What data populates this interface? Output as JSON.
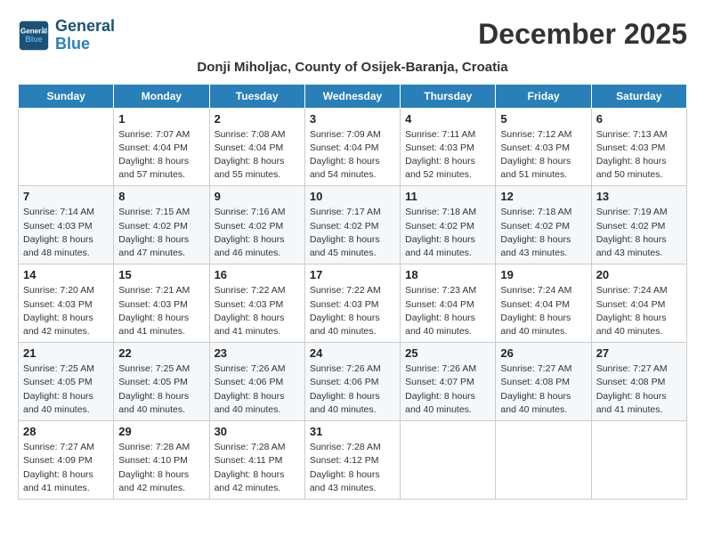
{
  "header": {
    "logo_line1": "General",
    "logo_line2": "Blue",
    "month_title": "December 2025",
    "subtitle": "Donji Miholjac, County of Osijek-Baranja, Croatia"
  },
  "weekdays": [
    "Sunday",
    "Monday",
    "Tuesday",
    "Wednesday",
    "Thursday",
    "Friday",
    "Saturday"
  ],
  "weeks": [
    [
      {
        "day": "",
        "info": ""
      },
      {
        "day": "1",
        "info": "Sunrise: 7:07 AM\nSunset: 4:04 PM\nDaylight: 8 hours\nand 57 minutes."
      },
      {
        "day": "2",
        "info": "Sunrise: 7:08 AM\nSunset: 4:04 PM\nDaylight: 8 hours\nand 55 minutes."
      },
      {
        "day": "3",
        "info": "Sunrise: 7:09 AM\nSunset: 4:04 PM\nDaylight: 8 hours\nand 54 minutes."
      },
      {
        "day": "4",
        "info": "Sunrise: 7:11 AM\nSunset: 4:03 PM\nDaylight: 8 hours\nand 52 minutes."
      },
      {
        "day": "5",
        "info": "Sunrise: 7:12 AM\nSunset: 4:03 PM\nDaylight: 8 hours\nand 51 minutes."
      },
      {
        "day": "6",
        "info": "Sunrise: 7:13 AM\nSunset: 4:03 PM\nDaylight: 8 hours\nand 50 minutes."
      }
    ],
    [
      {
        "day": "7",
        "info": "Sunrise: 7:14 AM\nSunset: 4:03 PM\nDaylight: 8 hours\nand 48 minutes."
      },
      {
        "day": "8",
        "info": "Sunrise: 7:15 AM\nSunset: 4:02 PM\nDaylight: 8 hours\nand 47 minutes."
      },
      {
        "day": "9",
        "info": "Sunrise: 7:16 AM\nSunset: 4:02 PM\nDaylight: 8 hours\nand 46 minutes."
      },
      {
        "day": "10",
        "info": "Sunrise: 7:17 AM\nSunset: 4:02 PM\nDaylight: 8 hours\nand 45 minutes."
      },
      {
        "day": "11",
        "info": "Sunrise: 7:18 AM\nSunset: 4:02 PM\nDaylight: 8 hours\nand 44 minutes."
      },
      {
        "day": "12",
        "info": "Sunrise: 7:18 AM\nSunset: 4:02 PM\nDaylight: 8 hours\nand 43 minutes."
      },
      {
        "day": "13",
        "info": "Sunrise: 7:19 AM\nSunset: 4:02 PM\nDaylight: 8 hours\nand 43 minutes."
      }
    ],
    [
      {
        "day": "14",
        "info": "Sunrise: 7:20 AM\nSunset: 4:03 PM\nDaylight: 8 hours\nand 42 minutes."
      },
      {
        "day": "15",
        "info": "Sunrise: 7:21 AM\nSunset: 4:03 PM\nDaylight: 8 hours\nand 41 minutes."
      },
      {
        "day": "16",
        "info": "Sunrise: 7:22 AM\nSunset: 4:03 PM\nDaylight: 8 hours\nand 41 minutes."
      },
      {
        "day": "17",
        "info": "Sunrise: 7:22 AM\nSunset: 4:03 PM\nDaylight: 8 hours\nand 40 minutes."
      },
      {
        "day": "18",
        "info": "Sunrise: 7:23 AM\nSunset: 4:04 PM\nDaylight: 8 hours\nand 40 minutes."
      },
      {
        "day": "19",
        "info": "Sunrise: 7:24 AM\nSunset: 4:04 PM\nDaylight: 8 hours\nand 40 minutes."
      },
      {
        "day": "20",
        "info": "Sunrise: 7:24 AM\nSunset: 4:04 PM\nDaylight: 8 hours\nand 40 minutes."
      }
    ],
    [
      {
        "day": "21",
        "info": "Sunrise: 7:25 AM\nSunset: 4:05 PM\nDaylight: 8 hours\nand 40 minutes."
      },
      {
        "day": "22",
        "info": "Sunrise: 7:25 AM\nSunset: 4:05 PM\nDaylight: 8 hours\nand 40 minutes."
      },
      {
        "day": "23",
        "info": "Sunrise: 7:26 AM\nSunset: 4:06 PM\nDaylight: 8 hours\nand 40 minutes."
      },
      {
        "day": "24",
        "info": "Sunrise: 7:26 AM\nSunset: 4:06 PM\nDaylight: 8 hours\nand 40 minutes."
      },
      {
        "day": "25",
        "info": "Sunrise: 7:26 AM\nSunset: 4:07 PM\nDaylight: 8 hours\nand 40 minutes."
      },
      {
        "day": "26",
        "info": "Sunrise: 7:27 AM\nSunset: 4:08 PM\nDaylight: 8 hours\nand 40 minutes."
      },
      {
        "day": "27",
        "info": "Sunrise: 7:27 AM\nSunset: 4:08 PM\nDaylight: 8 hours\nand 41 minutes."
      }
    ],
    [
      {
        "day": "28",
        "info": "Sunrise: 7:27 AM\nSunset: 4:09 PM\nDaylight: 8 hours\nand 41 minutes."
      },
      {
        "day": "29",
        "info": "Sunrise: 7:28 AM\nSunset: 4:10 PM\nDaylight: 8 hours\nand 42 minutes."
      },
      {
        "day": "30",
        "info": "Sunrise: 7:28 AM\nSunset: 4:11 PM\nDaylight: 8 hours\nand 42 minutes."
      },
      {
        "day": "31",
        "info": "Sunrise: 7:28 AM\nSunset: 4:12 PM\nDaylight: 8 hours\nand 43 minutes."
      },
      {
        "day": "",
        "info": ""
      },
      {
        "day": "",
        "info": ""
      },
      {
        "day": "",
        "info": ""
      }
    ]
  ]
}
